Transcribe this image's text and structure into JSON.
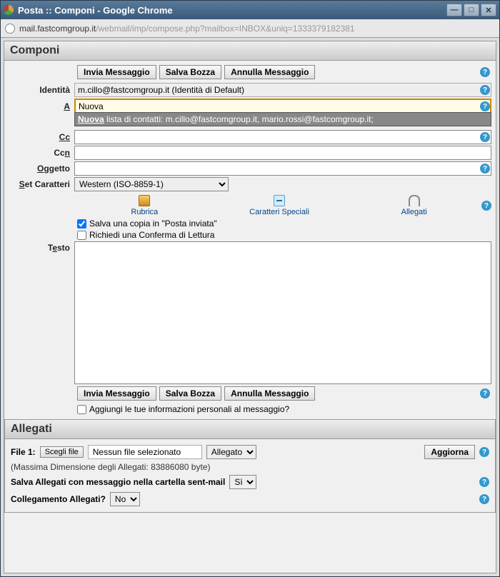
{
  "window": {
    "title": "Posta :: Componi - Google Chrome"
  },
  "address": {
    "host": "mail.fastcomgroup.it",
    "path": "/webmail/imp/compose.php?mailbox=INBOX&uniq=1333379182381"
  },
  "compose": {
    "header": "Componi",
    "actions": {
      "send": "Invia Messaggio",
      "draft": "Salva Bozza",
      "cancel": "Annulla Messaggio"
    },
    "labels": {
      "identity": "Identità",
      "to": "A",
      "cc": "Cc",
      "bcc": "Ccn",
      "subject": "Oggetto",
      "charset": "Set Caratteri",
      "text": "Testo"
    },
    "identity_value": "m.cillo@fastcomgroup.it (Identità di Default)",
    "to_value": "Nuova",
    "cc_value": "",
    "bcc_value": "",
    "subject_value": "",
    "suggestion": {
      "prefix": "Nuova",
      "rest": " lista di contatti: m.cillo@fastcomgroup.it, mario.rossi@fastcomgroup.it;"
    },
    "charset_value": "Western (ISO-8859-1)",
    "icons": {
      "rubrica": "Rubrica",
      "special": "Caratteri Speciali",
      "attach": "Allegati"
    },
    "save_copy": "Salva una copia in \"Posta inviata\"",
    "read_receipt": "Richiedi una Conferma di Lettura",
    "append_info": "Aggiungi le tue informazioni personali al messaggio?"
  },
  "attachments": {
    "header": "Allegati",
    "file1_label": "File 1:",
    "choose": "Scegli file",
    "nofile": "Nessun file selezionato",
    "disposition": "Allegato",
    "update": "Aggiorna",
    "maxsize": "(Massima Dimensione degli Allegati: 83886080 byte)",
    "save_sent_label": "Salva Allegati con messaggio nella cartella sent-mail",
    "save_sent_value": "Sì",
    "link_label": "Collegamento Allegati?",
    "link_value": "No"
  }
}
